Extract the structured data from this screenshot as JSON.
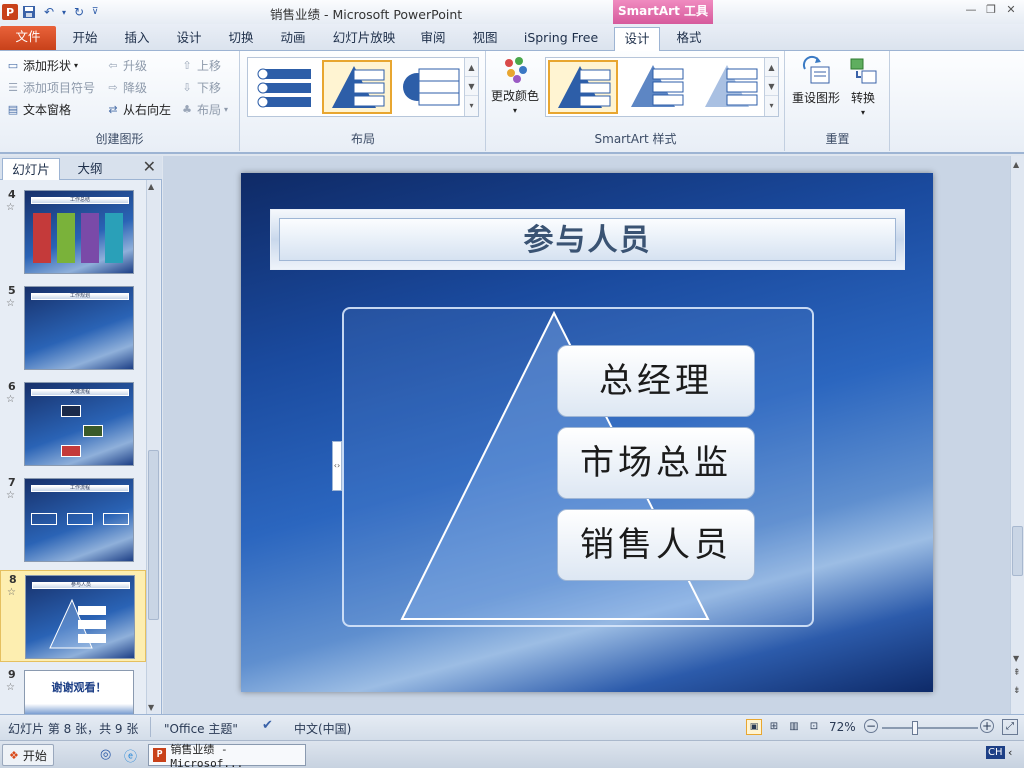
{
  "window": {
    "title": "销售业绩 - Microsoft PowerPoint",
    "contextual_tab_group": "SmartArt 工具",
    "controls": [
      "—",
      "❐",
      "✕"
    ]
  },
  "quick_access": [
    "save-icon",
    "undo-icon",
    "redo-icon",
    "customize-icon"
  ],
  "tabs": [
    {
      "label": "文件",
      "active": false
    },
    {
      "label": "开始",
      "active": false
    },
    {
      "label": "插入",
      "active": false
    },
    {
      "label": "设计",
      "active": false
    },
    {
      "label": "切换",
      "active": false
    },
    {
      "label": "动画",
      "active": false
    },
    {
      "label": "幻灯片放映",
      "active": false
    },
    {
      "label": "审阅",
      "active": false
    },
    {
      "label": "视图",
      "active": false
    },
    {
      "label": "iSpring Free",
      "active": false
    },
    {
      "label": "设计",
      "active": true
    },
    {
      "label": "格式",
      "active": false
    }
  ],
  "ribbon": {
    "create_graphic": {
      "label": "创建图形",
      "add_shape": "添加形状",
      "add_bullet": "添加项目符号",
      "text_pane": "文本窗格",
      "promote": "升级",
      "demote": "降级",
      "right_to_left": "从右向左",
      "move_up": "上移",
      "move_down": "下移",
      "layout": "布局"
    },
    "layouts": {
      "label": "布局"
    },
    "smartart_styles": {
      "label": "SmartArt 样式",
      "change_colors": "更改颜色"
    },
    "reset": {
      "label": "重置",
      "reset_graphic": "重设图形",
      "convert": "转换"
    }
  },
  "left_pane": {
    "tabs": [
      "幻灯片",
      "大纲"
    ],
    "slides": [
      {
        "number": "4",
        "title": "工作总结"
      },
      {
        "number": "5",
        "title": "工作规划"
      },
      {
        "number": "6",
        "title": "关键流程"
      },
      {
        "number": "7",
        "title": "工作流程"
      },
      {
        "number": "8",
        "title": "参与人员",
        "selected": true
      },
      {
        "number": "9",
        "title": "谢谢观看！"
      }
    ]
  },
  "slide": {
    "title": "参与人员",
    "smartart_items": [
      "总经理",
      "市场总监",
      "销售人员"
    ]
  },
  "status_bar": {
    "slide_info": "幻灯片 第 8 张，共 9 张",
    "theme": "\"Office 主题\"",
    "language": "中文(中国)",
    "zoom": "72%",
    "zoom_level": 0.72
  },
  "taskbar": {
    "start": "开始",
    "active_window": "销售业绩 - Microsof...",
    "input_method": "CH"
  },
  "colors": {
    "file_tab": "#c8411a",
    "contextual": "#d65a9c",
    "selection": "#e8a630"
  }
}
